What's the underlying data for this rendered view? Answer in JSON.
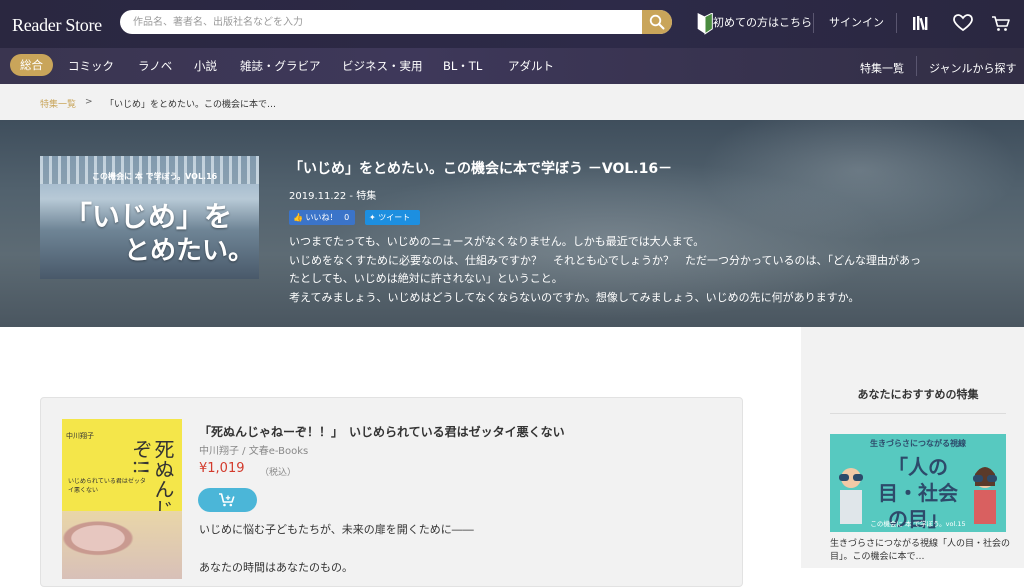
{
  "header": {
    "logo_text": "Reader Store",
    "search_placeholder": "作品名、著者名、出版社名などを入力",
    "beginner_link": "初めての方はこちら",
    "signin_link": "サインイン"
  },
  "category_nav": {
    "items": [
      "総合",
      "コミック",
      "ラノベ",
      "小説",
      "雑誌・グラビア",
      "ビジネス・実用",
      "BL・TL",
      "アダルト"
    ],
    "active": "総合",
    "right_links": [
      "特集一覧",
      "ジャンルから探す"
    ]
  },
  "breadcrumb": {
    "root": "特集一覧",
    "separator": ">",
    "current": "「いじめ」をとめたい。この機会に本で…"
  },
  "feature": {
    "thumb_series": "この機会に 本 で学ぼう。VOL.16",
    "thumb_line1": "「いじめ」を",
    "thumb_line2": "とめたい。",
    "title": "「いじめ」をとめたい。この機会に本で学ぼう －VOL.16－",
    "meta": "2019.11.22 - 特集",
    "like_label": "いいね！",
    "like_count": "0",
    "tweet_label": "ツイート",
    "body": [
      "いつまでたっても、いじめのニュースがなくなりません。しかも最近では大人まで。",
      "いじめをなくすために必要なのは、仕組みですか？　それとも心でしょうか？　ただ一つ分かっているのは、「どんな理由があっ",
      "たとしても、いじめは絶対に許されない」ということ。",
      "考えてみましょう、いじめはどうしてなくならないのですか。想像してみましょう、いじめの先に何がありますか。"
    ]
  },
  "book": {
    "cover_author": "中川翔子",
    "cover_title": "死ぬんじゃねーぞ!!",
    "cover_subtitle": "いじめられている君はゼッタイ悪くない",
    "title": "「死ぬんじゃねーぞ！！」　いじめられている君はゼッタイ悪くない",
    "author_publisher": "中川翔子 / 文春e-Books",
    "price": "¥1,019",
    "tax_note": "（税込）",
    "desc_line1": "いじめに悩む子どもたちが、未来の扉を開くために――",
    "desc_line2": "あなたの時間はあなたのもの。"
  },
  "sidebar": {
    "title": "あなたにおすすめの特集",
    "thumb_head": "生きづらさにつながる視線",
    "thumb_big": "「人の目・社会の目」",
    "thumb_foot": "この機会に 本 で学ぼう。vol.15",
    "caption": "生きづらさにつながる視線「人の目・社会の目」。この機会に本で…"
  },
  "colors": {
    "header_bg": "#2a2740",
    "accent_gold": "#c9a55a",
    "price_red": "#d33a2c",
    "cart_blue": "#4bb6d8",
    "fb_blue": "#3b74c9",
    "twitter_blue": "#1d8fe0"
  },
  "icons": {
    "search": "search-icon",
    "beginner": "beginner-mark-icon",
    "bookshelf": "bookshelf-icon",
    "favorite": "heart-icon",
    "cart": "cart-icon"
  }
}
